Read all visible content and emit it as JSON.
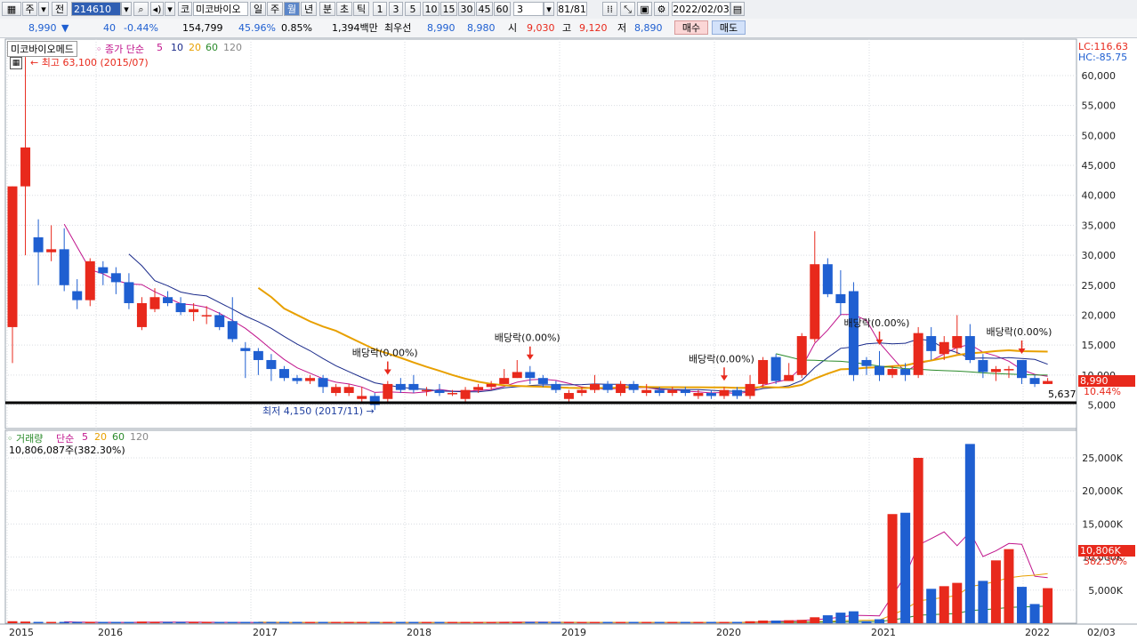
{
  "toolbar": {
    "market": "전",
    "code": "214610",
    "corp_btn": "코",
    "name": "미코바이오",
    "periods": [
      "일",
      "주",
      "월",
      "년"
    ],
    "period_selected": "월",
    "intervals": [
      "분",
      "초",
      "틱"
    ],
    "numbers": [
      "1",
      "3",
      "5",
      "10",
      "15",
      "30",
      "45",
      "60"
    ],
    "count": "3",
    "page": "81/81",
    "date": "2022/02/03"
  },
  "quote": {
    "price": "8,990",
    "change": "40",
    "rate": "-0.44%",
    "volume": "154,799",
    "pct1": "45.96%",
    "pct2": "0.85%",
    "amount": "1,394백만",
    "best_label": "최우선",
    "best1": "8,990",
    "best2": "8,980",
    "open_label": "시",
    "open": "9,030",
    "high_label": "고",
    "high": "9,120",
    "low_label": "저",
    "low": "8,890",
    "buy": "매수",
    "sell": "매도"
  },
  "price_panel": {
    "name": "미코바이오메드",
    "ma_title": "종가 단순",
    "ma_periods": [
      "5",
      "10",
      "20",
      "60",
      "120"
    ],
    "lc": "LC:116.63",
    "hc": "HC:-85.75",
    "max_label": "최고 63,100 (2015/07)",
    "min_label": "최저 4,150 (2017/11)",
    "current_tag": "8,990",
    "current_pct": "10.44%",
    "line_label": "5,637",
    "dividends": [
      "배당락(0.00%)",
      "배당락(0.00%)",
      "배당락(0.00%)",
      "배당락(0.00%)",
      "배당락(0.00%)"
    ]
  },
  "volume_panel": {
    "title": "거래량",
    "ma_title": "단순",
    "ma_periods": [
      "5",
      "20",
      "60",
      "120"
    ],
    "last_label": "10,806,087주(382.30%)",
    "current_tag": "10,806K",
    "current_pct": "382.30%"
  },
  "x_axis": [
    "2015",
    "2016",
    "2017",
    "2018",
    "2019",
    "2020",
    "2021",
    "2022",
    "02/03"
  ],
  "colors": {
    "up": "#e8291c",
    "down": "#1f5fd1",
    "ma5": "#c0148c",
    "ma10": "#1a2a8a",
    "ma20": "#e8a000",
    "ma60": "#2a8a2a"
  },
  "chart_data": {
    "type": "candlestick",
    "price_axis": {
      "ticks": [
        5000,
        10000,
        15000,
        20000,
        25000,
        30000,
        35000,
        40000,
        45000,
        50000,
        55000,
        60000
      ]
    },
    "volume_axis": {
      "unit": "K",
      "ticks": [
        5000,
        10000,
        15000,
        20000,
        25000
      ]
    },
    "candles": [
      [
        18000,
        41500,
        12000,
        41500
      ],
      [
        41500,
        48000,
        30000,
        63100
      ],
      [
        33000,
        30500,
        25000,
        36000
      ],
      [
        30500,
        31000,
        29000,
        35000
      ],
      [
        31000,
        25000,
        24000,
        34500
      ],
      [
        24000,
        22500,
        21000,
        26000
      ],
      [
        22500,
        29000,
        21500,
        29500
      ],
      [
        28000,
        27000,
        25000,
        29000
      ],
      [
        27000,
        25500,
        23500,
        28000
      ],
      [
        25500,
        22000,
        21000,
        27000
      ],
      [
        18000,
        22000,
        17500,
        23000
      ],
      [
        21000,
        23000,
        20500,
        24500
      ],
      [
        23000,
        22000,
        21500,
        24000
      ],
      [
        22000,
        20500,
        20000,
        23000
      ],
      [
        20500,
        21000,
        19000,
        22000
      ],
      [
        20000,
        20000,
        18500,
        21500
      ],
      [
        20000,
        18000,
        17500,
        20500
      ],
      [
        19000,
        16000,
        15500,
        23000
      ],
      [
        14500,
        14000,
        9500,
        15500
      ],
      [
        14000,
        12500,
        10000,
        14500
      ],
      [
        12500,
        11000,
        9000,
        13500
      ],
      [
        11000,
        9500,
        9000,
        11500
      ],
      [
        9500,
        9000,
        8500,
        10000
      ],
      [
        9000,
        9500,
        8500,
        10000
      ],
      [
        9500,
        8000,
        7000,
        10000
      ],
      [
        7000,
        8000,
        6500,
        8500
      ],
      [
        7000,
        8000,
        6500,
        8500
      ],
      [
        6000,
        6500,
        5500,
        8000
      ],
      [
        6500,
        5000,
        4150,
        7000
      ],
      [
        6000,
        8500,
        5500,
        9000
      ],
      [
        8500,
        7500,
        7000,
        9500
      ],
      [
        8500,
        7500,
        7000,
        10000
      ],
      [
        7500,
        7500,
        6500,
        8000
      ],
      [
        7500,
        7000,
        6500,
        8500
      ],
      [
        7000,
        7000,
        6500,
        7500
      ],
      [
        6000,
        7500,
        5500,
        8000
      ],
      [
        7500,
        8000,
        7000,
        8500
      ],
      [
        8000,
        8500,
        7500,
        9000
      ],
      [
        8500,
        9500,
        8500,
        11000
      ],
      [
        9500,
        10500,
        9500,
        12500
      ],
      [
        10500,
        9500,
        8500,
        11500
      ],
      [
        9500,
        8500,
        8000,
        10000
      ],
      [
        8500,
        7500,
        7000,
        9000
      ],
      [
        6000,
        7000,
        5500,
        7500
      ],
      [
        7000,
        7500,
        6500,
        8000
      ],
      [
        7500,
        8500,
        7000,
        10000
      ],
      [
        8500,
        7500,
        7000,
        9000
      ],
      [
        7000,
        8500,
        6500,
        9000
      ],
      [
        8500,
        7500,
        7000,
        9000
      ],
      [
        7000,
        7500,
        6500,
        8500
      ],
      [
        7500,
        7000,
        6500,
        8000
      ],
      [
        7000,
        7500,
        6500,
        8000
      ],
      [
        7500,
        7000,
        6500,
        8000
      ],
      [
        6500,
        7000,
        6000,
        7500
      ],
      [
        7000,
        6500,
        6000,
        7500
      ],
      [
        6500,
        7500,
        6000,
        8000
      ],
      [
        7500,
        6500,
        6000,
        8000
      ],
      [
        6500,
        8500,
        6000,
        10000
      ],
      [
        8500,
        12500,
        8000,
        13000
      ],
      [
        13000,
        9000,
        8500,
        13500
      ],
      [
        9000,
        10000,
        9000,
        12000
      ],
      [
        10000,
        16500,
        9500,
        17000
      ],
      [
        16000,
        28500,
        15500,
        34000
      ],
      [
        28500,
        23500,
        23000,
        29500
      ],
      [
        23500,
        22000,
        20000,
        27500
      ],
      [
        24000,
        10000,
        9000,
        25500
      ],
      [
        12500,
        11500,
        10000,
        13000
      ],
      [
        11500,
        10000,
        9000,
        14000
      ],
      [
        10000,
        11000,
        9500,
        11500
      ],
      [
        11000,
        10000,
        9000,
        12000
      ],
      [
        10000,
        17000,
        9500,
        18000
      ],
      [
        16500,
        14000,
        12500,
        18000
      ],
      [
        13500,
        15500,
        12500,
        16500
      ],
      [
        14500,
        16500,
        13500,
        20000
      ],
      [
        16500,
        12500,
        12000,
        18500
      ],
      [
        12500,
        10500,
        9500,
        13500
      ],
      [
        10500,
        11000,
        9000,
        11500
      ],
      [
        11000,
        11000,
        9500,
        11500
      ],
      [
        12500,
        9500,
        8500,
        12500
      ],
      [
        9500,
        8500,
        8000,
        10000
      ],
      [
        8500,
        9000,
        8500,
        9500
      ]
    ],
    "volume": [
      300,
      250,
      200,
      150,
      150,
      150,
      120,
      130,
      100,
      120,
      250,
      200,
      150,
      150,
      150,
      120,
      130,
      120,
      100,
      120,
      100,
      100,
      100,
      100,
      100,
      100,
      100,
      100,
      100,
      120,
      150,
      120,
      100,
      100,
      100,
      150,
      200,
      150,
      150,
      150,
      200,
      150,
      120,
      100,
      100,
      120,
      150,
      100,
      120,
      100,
      100,
      100,
      100,
      100,
      100,
      150,
      150,
      300,
      400,
      400,
      450,
      500,
      900,
      1200,
      1600,
      1800,
      300,
      600,
      16500,
      16700,
      25000,
      5200,
      5600,
      6100,
      27100,
      6400,
      9500,
      11200,
      5500,
      2900,
      5300,
      2900,
      4800,
      11200,
      10900,
      2900,
      10806
    ]
  }
}
